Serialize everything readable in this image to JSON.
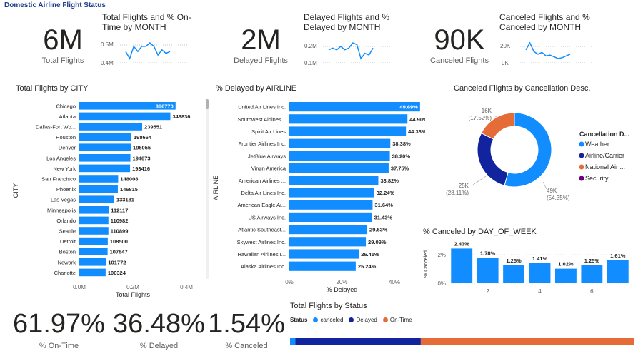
{
  "page_title": "Domestic Airline Flight Status",
  "kpis": [
    {
      "value": "6M",
      "label": "Total Flights",
      "spark_title": "Total Flights and % On-Time by MONTH",
      "ticks": [
        "0.5M",
        "0.4M"
      ]
    },
    {
      "value": "2M",
      "label": "Delayed Flights",
      "spark_title": "Delayed Flights and % Delayed by MONTH",
      "ticks": [
        "0.2M",
        "0.1M"
      ]
    },
    {
      "value": "90K",
      "label": "Canceled Flights",
      "spark_title": "Canceled Flights and % Canceled by MONTH",
      "ticks": [
        "20K",
        "0K"
      ]
    }
  ],
  "bottom_pcts": [
    {
      "value": "61.97%",
      "label": "% On-Time"
    },
    {
      "value": "36.48%",
      "label": "% Delayed"
    },
    {
      "value": "1.54%",
      "label": "% Canceled"
    }
  ],
  "colors": {
    "blue": "#118DFF",
    "navy": "#12239E",
    "orange": "#E66C37",
    "purple": "#6B007B",
    "title": "#1a3d8f"
  },
  "chart_data": [
    {
      "id": "city",
      "type": "bar",
      "orientation": "horizontal",
      "title": "Total Flights by CITY",
      "xlabel": "Total Flights",
      "ylabel": "CITY",
      "xlim": [
        0,
        400000
      ],
      "xticks": [
        "0.0M",
        "0.2M",
        "0.4M"
      ],
      "categories": [
        "Chicago",
        "Atlanta",
        "Dallas-Fort Wo...",
        "Houston",
        "Denver",
        "Los Angeles",
        "New York",
        "San Francisco",
        "Phoenix",
        "Las Vegas",
        "Minneapolis",
        "Orlando",
        "Seattle",
        "Detroit",
        "Boston",
        "Newark",
        "Charlotte"
      ],
      "values": [
        366770,
        346836,
        239551,
        198664,
        196055,
        194673,
        193416,
        148008,
        146815,
        133181,
        112117,
        110982,
        110899,
        108500,
        107847,
        101772,
        100324
      ]
    },
    {
      "id": "airline",
      "type": "bar",
      "orientation": "horizontal",
      "title": "% Delayed by AIRLINE",
      "xlabel": "% Delayed",
      "ylabel": "AIRLINE",
      "xlim": [
        0,
        50
      ],
      "xticks": [
        "0%",
        "20%",
        "40%"
      ],
      "categories": [
        "United Air Lines Inc.",
        "Southwest Airlines...",
        "Spirit Air Lines",
        "Frontier Airlines Inc.",
        "JetBlue Airways",
        "Virgin America",
        "American Airlines ...",
        "Delta Air Lines Inc.",
        "American Eagle Ai...",
        "US Airways Inc.",
        "Atlantic Southeast...",
        "Skywest Airlines Inc.",
        "Hawaiian Airlines I...",
        "Alaska Airlines Inc."
      ],
      "values": [
        49.69,
        44.9,
        44.33,
        38.38,
        38.2,
        37.75,
        33.82,
        32.24,
        31.64,
        31.43,
        29.63,
        29.09,
        26.41,
        25.24
      ],
      "labels": [
        "49.69%",
        "44.90%",
        "44.33%",
        "38.38%",
        "38.20%",
        "37.75%",
        "33.82%",
        "32.24%",
        "31.64%",
        "31.43%",
        "29.63%",
        "29.09%",
        "26.41%",
        "25.24%"
      ]
    },
    {
      "id": "cancel_desc",
      "type": "pie",
      "donut": true,
      "title": "Canceled Flights by Cancellation Desc.",
      "legend_title": "Cancellation D...",
      "legend": [
        "Weather",
        "Airline/Carrier",
        "National Air ...",
        "Security"
      ],
      "values": [
        54.35,
        28.11,
        17.52,
        0.02
      ],
      "slice_labels": [
        {
          "value": "49K",
          "pct": "(54.35%)"
        },
        {
          "value": "25K",
          "pct": "(28.11%)"
        },
        {
          "value": "16K",
          "pct": "(17.52%)"
        }
      ]
    },
    {
      "id": "dow",
      "type": "bar",
      "title": "% Canceled by DAY_OF_WEEK",
      "ylabel": "% Canceled",
      "ylim": [
        0,
        2.6
      ],
      "yticks": [
        "2%",
        "0%"
      ],
      "categories": [
        1,
        2,
        3,
        4,
        5,
        6,
        7
      ],
      "xticks": [
        "2",
        "4",
        "6"
      ],
      "values": [
        2.43,
        1.78,
        1.25,
        1.41,
        1.02,
        1.25,
        1.61
      ],
      "labels": [
        "2.43%",
        "1.78%",
        "1.25%",
        "1.41%",
        "1.02%",
        "1.25%",
        "1.61%"
      ]
    },
    {
      "id": "status",
      "type": "bar",
      "stacked": true,
      "title": "Total Flights by Status",
      "legend_title": "Status",
      "legend": [
        "canceled",
        "Delayed",
        "On-Time"
      ],
      "values": [
        1.54,
        36.48,
        61.97
      ]
    },
    {
      "id": "spark_total",
      "type": "line",
      "values": [
        0.47,
        0.43,
        0.5,
        0.47,
        0.5,
        0.5,
        0.52,
        0.5,
        0.45,
        0.48,
        0.46,
        0.47
      ]
    },
    {
      "id": "spark_delayed",
      "type": "line",
      "values": [
        0.17,
        0.18,
        0.17,
        0.19,
        0.17,
        0.18,
        0.21,
        0.2,
        0.12,
        0.15,
        0.14,
        0.18
      ]
    },
    {
      "id": "spark_canceled",
      "type": "line",
      "values": [
        14,
        22,
        12,
        9,
        11,
        7,
        8,
        6,
        4,
        5,
        7,
        9
      ]
    }
  ]
}
